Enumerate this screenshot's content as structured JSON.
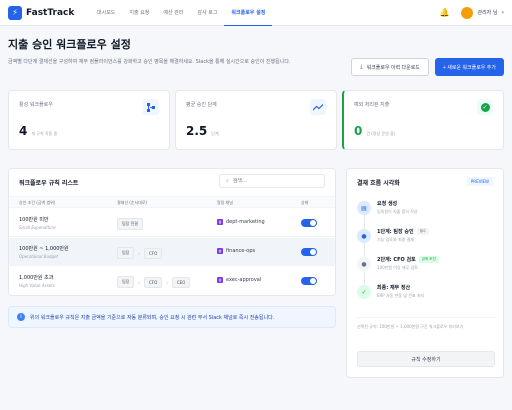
{
  "app": {
    "name": "FastTrack",
    "logo_icon": "bolt-icon"
  },
  "nav": [
    {
      "label": "대시보드",
      "active": false
    },
    {
      "label": "지출 요청",
      "active": false
    },
    {
      "label": "예산 관리",
      "active": false
    },
    {
      "label": "감사 로그",
      "active": false
    },
    {
      "label": "워크플로우 설정",
      "active": true
    }
  ],
  "user": {
    "name": "관리자 님"
  },
  "page": {
    "title": "지출 승인 워크플로우 설정",
    "description": "금액별 다단계 결재선을 구성하여 재무 컴플라이언스를 강화하고 승인 병목을 해결하세요. Slack을 통해 실시간으로 승인이 진행됩니다.",
    "download_label": "워크플로우 이력 다운로드",
    "add_label": "+ 새로운 워크플로우 추가"
  },
  "stats": [
    {
      "label": "활성 워크플로우",
      "value": "4",
      "unit": "개 규칙 작동 중",
      "icon": "flow-icon"
    },
    {
      "label": "평균 승인 단계",
      "value": "2.5",
      "unit": "단계",
      "icon": "trend-icon"
    },
    {
      "label": "예외 처리된 지출",
      "value": "0",
      "unit": "건 (정상 운영 중)",
      "icon": "check-icon"
    }
  ],
  "table": {
    "title": "워크플로우 규칙 리스트",
    "search_placeholder": "검색...",
    "columns": [
      "승인 조건 (금액 범위)",
      "결재선 (순서대로)",
      "알림 채널",
      "상태"
    ],
    "rows": [
      {
        "condition": "100만원 미만",
        "sub": "Small Expenditure",
        "steps": [
          "팀장 전결"
        ],
        "channel": "dept-marketing",
        "enabled": true
      },
      {
        "condition": "100만원 ~ 1,000만원",
        "sub": "Operational Budget",
        "steps": [
          "팀장",
          "CFO"
        ],
        "channel": "finance-ops",
        "enabled": true
      },
      {
        "condition": "1,000만원 초과",
        "sub": "High Value Assets",
        "steps": [
          "팀장",
          "CFO",
          "CEO"
        ],
        "channel": "exec-approval",
        "enabled": true
      }
    ]
  },
  "info": {
    "text": "위의 워크플로우 규칙은 지출 금액을 기준으로 자동 분류되며, 승인 요청 시 관련 부서 Slack 채널로 즉시 전송됩니다."
  },
  "flow": {
    "title": "결재 흐름 시각화",
    "badge": "PREVIEW",
    "steps": [
      {
        "title": "요청 생성",
        "sub": "임직원이 지출 품의 작성",
        "badge": ""
      },
      {
        "title": "1단계: 팀장 승인",
        "sub": "기능 검토와 최종 결재",
        "badge": "필수"
      },
      {
        "title": "2단계: CFO 검토",
        "sub": "100만원 이상 재무 검토",
        "badge": "금액 조건"
      },
      {
        "title": "최종: 재무 정산",
        "sub": "ERP 자동 연동 및 전표 처리",
        "badge": ""
      }
    ],
    "note": "선택된 규칙: 100만원 ~ 1,000만원 구간 워크플로우 미리보기",
    "button_label": "규칙 수정하기"
  }
}
